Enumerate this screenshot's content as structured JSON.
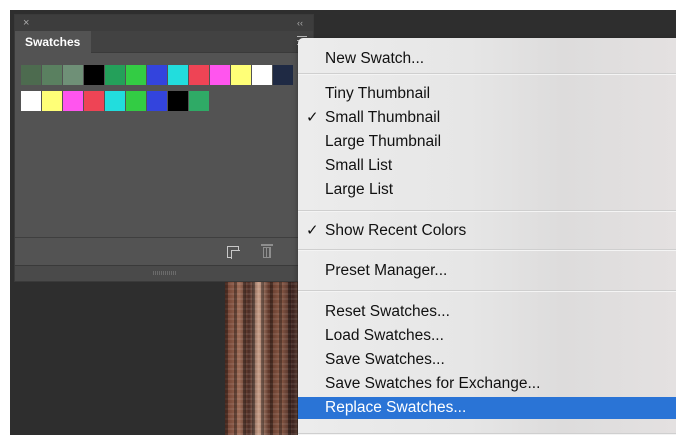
{
  "panel": {
    "tab_label": "Swatches",
    "close_glyph": "×",
    "collapse_glyph": "‹‹",
    "rows": [
      [
        "#4d6b4f",
        "#5a8060",
        "#6f9077",
        "#000000",
        "#24a05a",
        "#33cc44",
        "#3344dd",
        "#22dddd",
        "#ee4455",
        "#ff55ee",
        "#ffff77",
        "#ffffff",
        "#1f2a44"
      ],
      [
        "#ffffff",
        "#ffff77",
        "#ff55ee",
        "#ee4455",
        "#22dddd",
        "#33cc44",
        "#3344dd",
        "#000000",
        "#2faa66"
      ]
    ],
    "footer": {
      "new_swatch_icon": "new-swatch-icon",
      "trash_icon": "trash-icon"
    }
  },
  "menu": {
    "items": [
      {
        "label": "New Swatch...",
        "checked": false,
        "highlighted": false
      },
      {
        "label": "Tiny Thumbnail",
        "checked": false,
        "highlighted": false
      },
      {
        "label": "Small Thumbnail",
        "checked": true,
        "highlighted": false
      },
      {
        "label": "Large Thumbnail",
        "checked": false,
        "highlighted": false
      },
      {
        "label": "Small List",
        "checked": false,
        "highlighted": false
      },
      {
        "label": "Large List",
        "checked": false,
        "highlighted": false
      },
      {
        "label": "Show Recent Colors",
        "checked": true,
        "highlighted": false
      },
      {
        "label": "Preset Manager...",
        "checked": false,
        "highlighted": false
      },
      {
        "label": "Reset Swatches...",
        "checked": false,
        "highlighted": false
      },
      {
        "label": "Load Swatches...",
        "checked": false,
        "highlighted": false
      },
      {
        "label": "Save Swatches...",
        "checked": false,
        "highlighted": false
      },
      {
        "label": "Save Swatches for Exchange...",
        "checked": false,
        "highlighted": false
      },
      {
        "label": "Replace Swatches...",
        "checked": false,
        "highlighted": true
      }
    ],
    "check_glyph": "✓",
    "highlight_color": "#2a74d6"
  }
}
